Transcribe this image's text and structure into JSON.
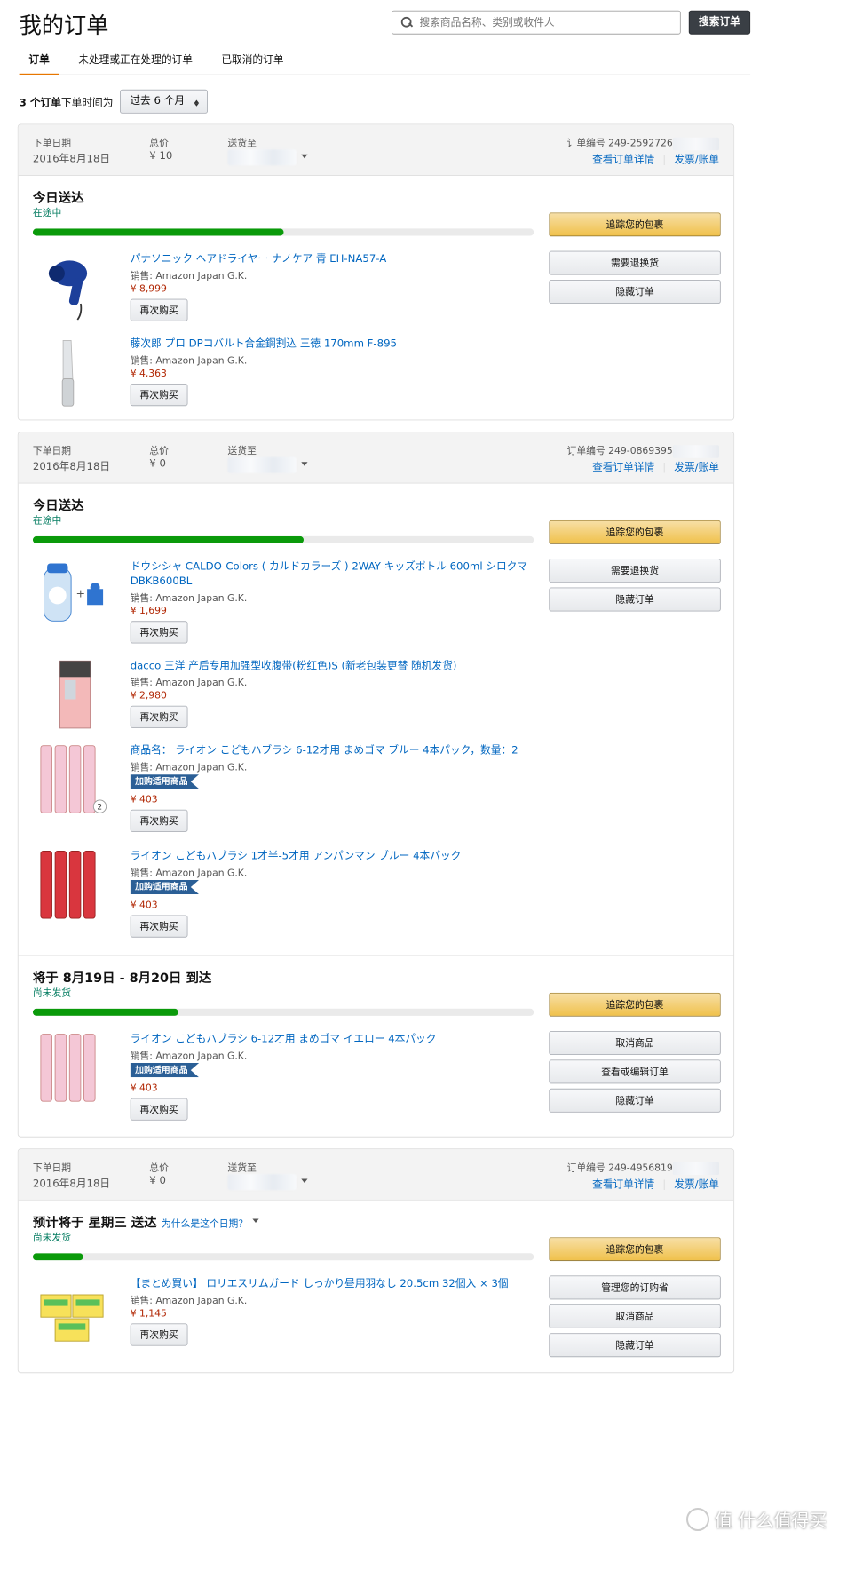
{
  "header": {
    "title": "我的订单",
    "search_placeholder": "搜索商品名称、类别或收件人",
    "search_button": "搜索订单"
  },
  "tabs": [
    {
      "label": "订单"
    },
    {
      "label": "未处理或正在处理的订单"
    },
    {
      "label": "已取消的订单"
    }
  ],
  "filter": {
    "count": "3 个订单",
    "label": "下单时间为",
    "select": "过去 6 个月"
  },
  "labels": {
    "order_date": "下单日期",
    "total": "总价",
    "ship_to": "送货至",
    "order_number": "订单编号",
    "view_details": "查看订单详情",
    "invoice": "发票/账单",
    "seller": "销售: Amazon Japan G.K.",
    "rebuy": "再次购买",
    "addon_badge": "加购适用商品"
  },
  "orders": [
    {
      "date": "2016年8月18日",
      "total": "¥ 10",
      "number": "249-2592726",
      "shipments": [
        {
          "title": "今日送达",
          "status": "在途中",
          "progress": 0.5,
          "buttons": [
            "追踪您的包裹",
            "需要退换货",
            "隐藏订单"
          ],
          "items": [
            {
              "name": "パナソニック ヘアドライヤー ナノケア 青 EH-NA57-A",
              "price": "¥ 8,999"
            },
            {
              "name": "藤次郎 プロ DPコバルト合金鋼割込 三徳 170mm F-895",
              "price": "¥ 4,363"
            }
          ]
        }
      ]
    },
    {
      "date": "2016年8月18日",
      "total": "¥ 0",
      "number": "249-0869395",
      "shipments": [
        {
          "title": "今日送达",
          "status": "在途中",
          "progress": 0.54,
          "buttons": [
            "追踪您的包裹",
            "需要退换货",
            "隐藏订单"
          ],
          "items": [
            {
              "name": "ドウシシャ CALDO-Colors ( カルドカラーズ ) 2WAY キッズボトル 600ml シロクマ DBKB600BL",
              "price": "¥ 1,699"
            },
            {
              "name": "dacco 三洋 产后专用加强型收腹带(粉红色)S (新老包装更替 随机发货)",
              "price": "¥ 2,980"
            },
            {
              "name": "商品名： ライオン こどもハブラシ 6-12才用 まめゴマ ブルー 4本パック，数量：2",
              "price": "¥ 403",
              "qty": "2"
            },
            {
              "name": "ライオン こどもハブラシ 1才半-5才用 アンパンマン ブルー 4本パック",
              "price": "¥ 403"
            }
          ]
        },
        {
          "title": "将于 8月19日 - 8月20日 到达",
          "status": "尚未发货",
          "progress": 0.29,
          "buttons": [
            "追踪您的包裹",
            "取消商品",
            "查看或编辑订单",
            "隐藏订单"
          ],
          "items": [
            {
              "name": "ライオン こどもハブラシ 6-12才用 まめゴマ イエロー 4本パック",
              "price": "¥ 403"
            }
          ]
        }
      ]
    },
    {
      "date": "2016年8月18日",
      "total": "¥ 0",
      "number": "249-4956819",
      "shipments": [
        {
          "title": "预计将于 星期三 送达",
          "why": "为什么是这个日期？",
          "status": "尚未发货",
          "progress": 0.1,
          "buttons": [
            "追踪您的包裹",
            "管理您的订购省",
            "取消商品",
            "隐藏订单"
          ],
          "items": [
            {
              "name": "【まとめ買い】 ロリエスリムガード しっかり昼用羽なし 20.5cm 32個入 × 3個",
              "price": "¥ 1,145"
            }
          ]
        }
      ]
    }
  ],
  "watermark": "值 什么值得买"
}
